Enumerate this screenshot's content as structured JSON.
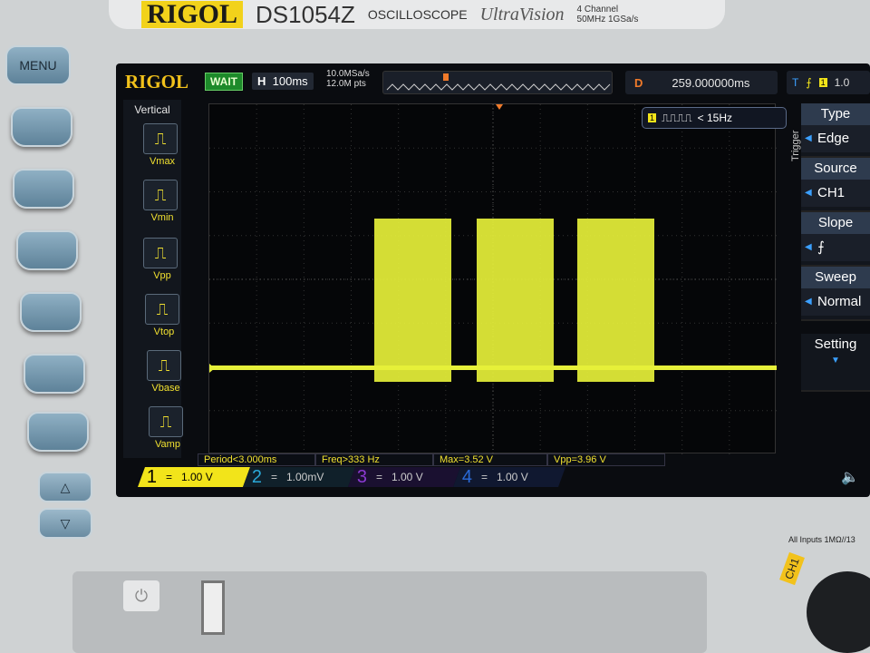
{
  "brand": {
    "logo": "RIGOL",
    "model": "DS1054Z",
    "type": "OSCILLOSCOPE",
    "series": "UltraVision",
    "channels": "4 Channel",
    "spec": "50MHz 1GSa/s"
  },
  "panel": {
    "menu_label": "MENU",
    "inputs_label": "All Inputs 1MΩ//13",
    "ch1_label": "CH1"
  },
  "status": {
    "logo": "RIGOL",
    "run_state": "WAIT",
    "h_label": "H",
    "timebase": "100ms",
    "sample_rate": "10.0MSa/s",
    "mem_depth": "12.0M pts",
    "delay_label": "D",
    "delay": "259.000000ms",
    "trigger_label": "T",
    "trigger_level": "1.0"
  },
  "vertical": {
    "title": "Vertical",
    "items": [
      {
        "label": "Vmax"
      },
      {
        "label": "Vmin"
      },
      {
        "label": "Vpp"
      },
      {
        "label": "Vtop"
      },
      {
        "label": "Vbase"
      },
      {
        "label": "Vamp"
      }
    ]
  },
  "trigger_freq": "< 15Hz",
  "trigger_menu": {
    "title": "Trigger",
    "items": [
      {
        "head": "Type",
        "value": "Edge"
      },
      {
        "head": "Source",
        "value": "CH1"
      },
      {
        "head": "Slope",
        "value": "⨍"
      },
      {
        "head": "Sweep",
        "value": "Normal"
      },
      {
        "head": "Setting",
        "value": "▼"
      }
    ]
  },
  "measurements": [
    "Period<3.000ms",
    "Freq>333 Hz",
    "Max=3.52 V",
    "Vpp=3.96 V"
  ],
  "channels": [
    {
      "num": "1",
      "coupling": "=",
      "scale": "1.00 V",
      "color": "#f2e41a"
    },
    {
      "num": "2",
      "coupling": "=",
      "scale": "1.00mV",
      "color": "#2aa8d8"
    },
    {
      "num": "3",
      "coupling": "=",
      "scale": "1.00 V",
      "color": "#8a3ad0"
    },
    {
      "num": "4",
      "coupling": "=",
      "scale": "1.00 V",
      "color": "#2a6ad8"
    }
  ],
  "waveform": {
    "color": "#e6f03a",
    "bursts": 3
  }
}
